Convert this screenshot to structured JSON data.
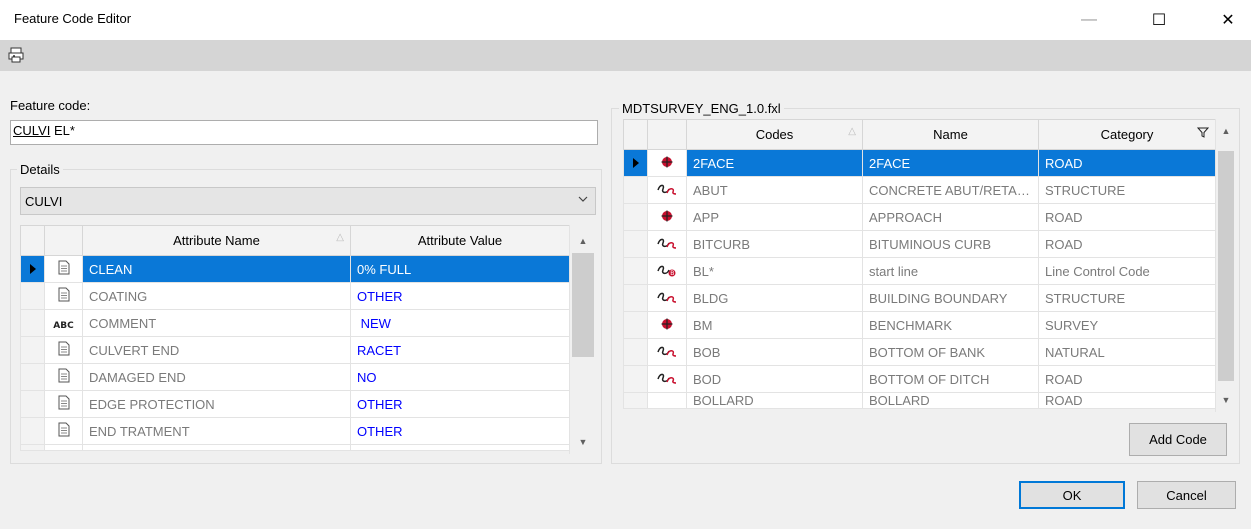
{
  "window": {
    "title": "Feature Code Editor",
    "minimize_glyph": "—",
    "maximize_glyph": "☐",
    "close_glyph": "✕"
  },
  "toolbar": {
    "icon": "print-preview-icon"
  },
  "feature_code": {
    "label": "Feature code:",
    "value_underlined": "CULVI",
    "value_rest": " EL*"
  },
  "details": {
    "legend": "Details",
    "combo_value": "CULVI",
    "columns": {
      "name": "Attribute Name",
      "value": "Attribute Value"
    },
    "rows": [
      {
        "icon": "document-icon",
        "name": "CLEAN",
        "value": "0% FULL",
        "selected": true
      },
      {
        "icon": "document-icon",
        "name": "COATING",
        "value": "OTHER"
      },
      {
        "icon": "abc-text-icon",
        "name": "COMMENT",
        "value": " NEW"
      },
      {
        "icon": "document-icon",
        "name": "CULVERT END",
        "value": "RACET"
      },
      {
        "icon": "document-icon",
        "name": "DAMAGED END",
        "value": "NO"
      },
      {
        "icon": "document-icon",
        "name": "EDGE PROTECTION",
        "value": "OTHER"
      },
      {
        "icon": "document-icon",
        "name": "END TRATMENT",
        "value": "OTHER"
      }
    ]
  },
  "library": {
    "legend": "MDTSURVEY_ENG_1.0.fxl",
    "columns": {
      "codes": "Codes",
      "name": "Name",
      "category": "Category"
    },
    "rows": [
      {
        "icon": "point-icon",
        "code": "2FACE",
        "name": "2FACE",
        "category": "ROAD",
        "selected": true
      },
      {
        "icon": "line-icon",
        "code": "ABUT",
        "name": "CONCRETE ABUT/RETAINING WALL",
        "category": "STRUCTURE"
      },
      {
        "icon": "point-icon",
        "code": "APP",
        "name": "APPROACH",
        "category": "ROAD"
      },
      {
        "icon": "line-icon",
        "code": "BITCURB",
        "name": "BITUMINOUS CURB",
        "category": "ROAD"
      },
      {
        "icon": "line-control-icon",
        "code": "BL*",
        "name": "start line",
        "category": "Line Control Code"
      },
      {
        "icon": "line-icon",
        "code": "BLDG",
        "name": "BUILDING BOUNDARY",
        "category": "STRUCTURE"
      },
      {
        "icon": "point-icon",
        "code": "BM",
        "name": "BENCHMARK",
        "category": "SURVEY"
      },
      {
        "icon": "line-icon",
        "code": "BOB",
        "name": "BOTTOM OF BANK",
        "category": "NATURAL"
      },
      {
        "icon": "line-icon",
        "code": "BOD",
        "name": "BOTTOM OF DITCH",
        "category": "ROAD"
      },
      {
        "icon": "point-icon",
        "code": "BOLLARD",
        "name": "BOLLARD",
        "category": "ROAD"
      }
    ]
  },
  "buttons": {
    "add_code": "Add Code",
    "ok": "OK",
    "cancel": "Cancel"
  }
}
